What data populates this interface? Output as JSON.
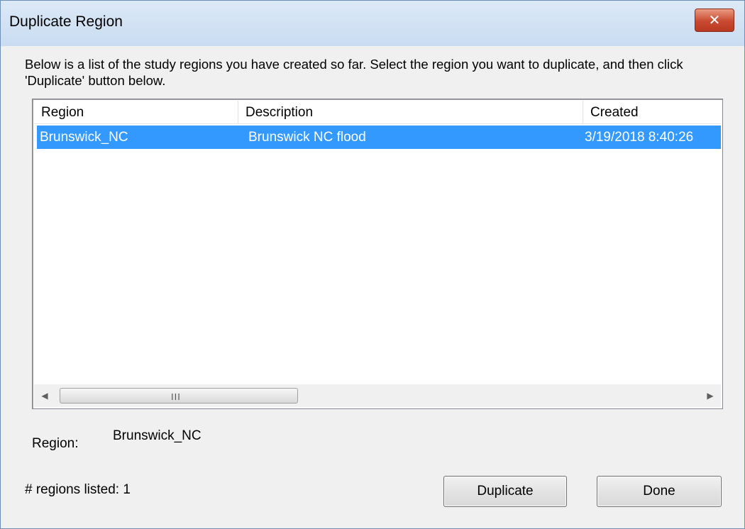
{
  "window": {
    "title": "Duplicate Region",
    "close_symbol": "✕"
  },
  "instructions": "Below is a list of the study regions you have created so far.  Select the region you want to duplicate, and then click 'Duplicate' button below.",
  "table": {
    "columns": [
      "Region",
      "Description",
      "Created"
    ],
    "rows": [
      {
        "region": "Brunswick_NC",
        "description": "Brunswick NC flood",
        "created": "3/19/2018 8:40:26",
        "selected": true
      }
    ]
  },
  "scrollbar": {
    "left_arrow": "◀",
    "right_arrow": "▶",
    "grip": "III"
  },
  "selection": {
    "label": "Region:",
    "value": "Brunswick_NC"
  },
  "count_text": "# regions listed: 1",
  "buttons": {
    "duplicate": "Duplicate",
    "done": "Done"
  },
  "icons": {
    "close": "close-icon",
    "scroll_left": "scroll-left-icon",
    "scroll_right": "scroll-right-icon"
  },
  "colors": {
    "selection": "#3399ff",
    "close_button": "#c94a2f",
    "titlebar": "#dce9f7"
  }
}
